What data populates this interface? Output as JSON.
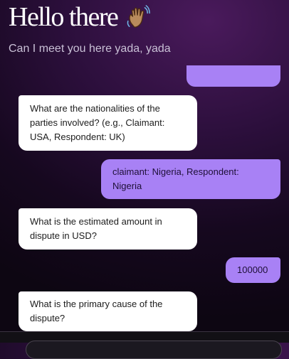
{
  "header": {
    "title": "Hello there",
    "subtitle": "Can I meet you here yada, yada"
  },
  "icons": {
    "wave": "waving-hand-icon"
  },
  "colors": {
    "user_bubble": "#a881f5",
    "bot_bubble": "#ffffff",
    "background_dark": "#0d0612",
    "background_glow": "#4a1a5c"
  },
  "messages": [
    {
      "role": "bot",
      "text": "What are the nationalities of the parties involved? (e.g., Claimant: USA, Respondent: UK)"
    },
    {
      "role": "user",
      "text": "claimant: Nigeria, Respondent: Nigeria"
    },
    {
      "role": "bot",
      "text": "What is the estimated amount in dispute in USD?"
    },
    {
      "role": "user",
      "text": "100000"
    },
    {
      "role": "bot",
      "text": "What is the primary cause of the dispute?"
    }
  ],
  "input": {
    "placeholder": ""
  }
}
